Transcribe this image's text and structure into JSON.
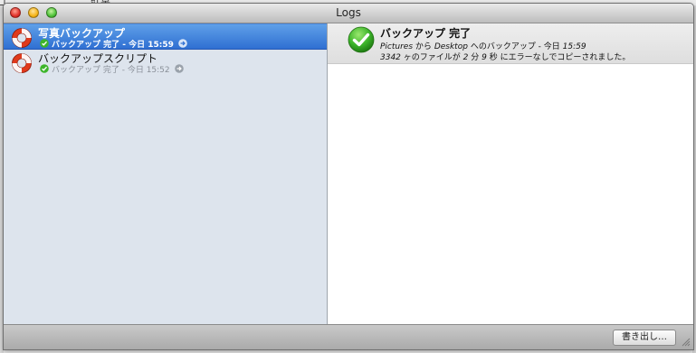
{
  "background": {
    "text": "紅草",
    "left_text": "ロ"
  },
  "window": {
    "title": "Logs"
  },
  "sidebar": {
    "items": [
      {
        "title": "写真バックアップ",
        "status": "バックアップ 完了 - 今日 15:59",
        "selected": true
      },
      {
        "title": "バックアップスクリプト",
        "status": "バックアップ 完了 - 今日 15:52",
        "selected": false
      }
    ]
  },
  "detail": {
    "title": "バックアップ 完了",
    "line1": {
      "source": "Pictures",
      "from_text": "から",
      "dest": "Desktop",
      "to_text": "へのバックアップ - 今日",
      "time": "15:59"
    },
    "line2": {
      "count": "3342",
      "files_text": "ヶのファイルが",
      "minutes": "2",
      "min_text": "分",
      "seconds": "9",
      "sec_text": "秒 にエラーなしでコピーされました。"
    }
  },
  "footer": {
    "export_label": "書き出し…"
  },
  "colors": {
    "selection": "#3a7bd9",
    "success": "#3db52a",
    "lifebuoy": "#e03a1c"
  }
}
